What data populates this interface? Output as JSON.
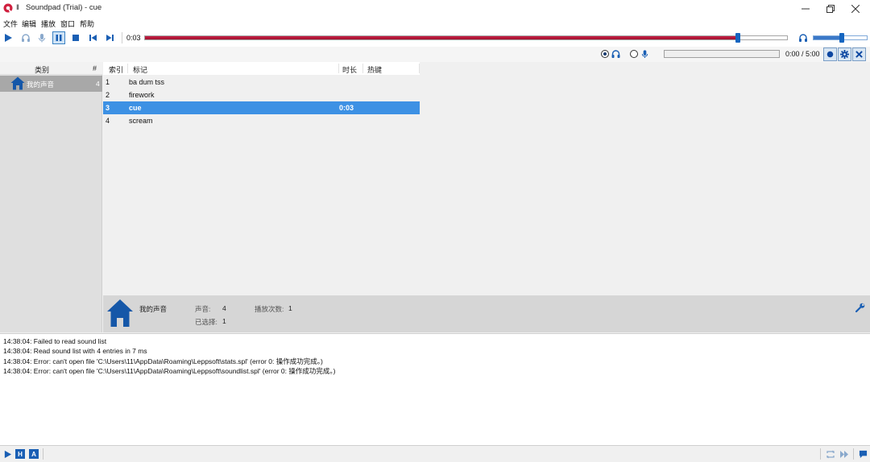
{
  "window": {
    "title": "Soundpad (Trial) - cue",
    "state_glyph": "II",
    "controls": {
      "minimize": "minimize-icon",
      "maximize": "restore-icon",
      "close": "close-icon"
    }
  },
  "menu": [
    "文件",
    "编辑",
    "播放",
    "窗口",
    "帮助"
  ],
  "toolbar": {
    "buttons": [
      "play-icon",
      "headphones-icon",
      "microphone-icon",
      "pause-icon",
      "stop-icon",
      "previous-icon",
      "next-icon"
    ],
    "current_time": "0:03",
    "progress": 0.925,
    "volume": 0.55,
    "accent_color": "#c01c40",
    "thumb_color": "#1565c0"
  },
  "recording": {
    "time": "0:00 / 5:00",
    "speakers_selected": true,
    "microphone_selected": false,
    "buttons": [
      "record-icon",
      "settings-icon",
      "close-icon"
    ]
  },
  "categories": {
    "header_label": "类别",
    "header_count": "#",
    "items": [
      {
        "label": "我的声音",
        "count": "4"
      }
    ]
  },
  "sounds": {
    "columns": [
      "索引",
      "标记",
      "时长",
      "热键"
    ],
    "rows": [
      {
        "index": "1",
        "name": "ba dum tss",
        "duration": "",
        "hotkey": ""
      },
      {
        "index": "2",
        "name": "firework",
        "duration": "",
        "hotkey": ""
      },
      {
        "index": "3",
        "name": "cue",
        "duration": "0:03",
        "hotkey": ""
      },
      {
        "index": "4",
        "name": "scream",
        "duration": "",
        "hotkey": ""
      }
    ],
    "selected_index": 2,
    "selection_color": "#3d91e4"
  },
  "info": {
    "category_name": "我的声音",
    "sounds_label": "声音:",
    "sounds_value": "4",
    "plays_label": "播放次数:",
    "plays_value": "1",
    "selected_label": "已选择:",
    "selected_value": "1"
  },
  "log": [
    "14:38:04: Failed to read sound list",
    "14:38:04: Read sound list with 4 entries in 7 ms",
    "14:38:04: Error: can't open file 'C:\\Users\\11\\AppData\\Roaming\\Leppsoft\\stats.spl' (error 0: 操作成功完成。)",
    "14:38:04: Error: can't open file 'C:\\Users\\11\\AppData\\Roaming\\Leppsoft\\soundlist.spl' (error 0: 操作成功完成。)"
  ],
  "statusbar": {
    "left_buttons": [
      "play-icon",
      "H",
      "A"
    ],
    "right_buttons": [
      "repeat-icon",
      "skip-forward-icon",
      "chat-icon"
    ]
  }
}
